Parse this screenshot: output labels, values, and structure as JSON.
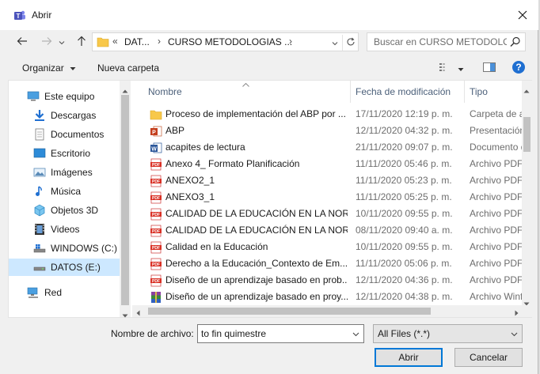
{
  "window": {
    "title": "Abrir"
  },
  "address": {
    "overflow": "«",
    "crumbs": [
      "DAT...",
      "CURSO METODOLOGIAS ..."
    ],
    "separator": "›"
  },
  "search": {
    "placeholder": "Buscar en CURSO METODOLO..."
  },
  "toolbar": {
    "organize": "Organizar",
    "new_folder": "Nueva carpeta"
  },
  "sidebar": {
    "items": [
      {
        "label": "Este equipo",
        "icon": "computer-icon"
      },
      {
        "label": "Descargas",
        "icon": "download-icon"
      },
      {
        "label": "Documentos",
        "icon": "documents-icon"
      },
      {
        "label": "Escritorio",
        "icon": "desktop-icon"
      },
      {
        "label": "Imágenes",
        "icon": "pictures-icon"
      },
      {
        "label": "Música",
        "icon": "music-icon"
      },
      {
        "label": "Objetos 3D",
        "icon": "3d-objects-icon"
      },
      {
        "label": "Videos",
        "icon": "videos-icon"
      },
      {
        "label": "WINDOWS (C:)",
        "icon": "windows-drive-icon"
      },
      {
        "label": "DATOS (E:)",
        "icon": "drive-icon"
      },
      {
        "label": "Red",
        "icon": "network-icon"
      }
    ]
  },
  "columns": {
    "name": "Nombre",
    "date": "Fecha de modificación",
    "type": "Tipo"
  },
  "files": [
    {
      "name": "Proceso de implementación del ABP por ...",
      "date": "17/11/2020 12:19 p. m.",
      "type": "Carpeta de ar",
      "icon": "folder-icon"
    },
    {
      "name": "ABP",
      "date": "12/11/2020 04:32 p. m.",
      "type": "Presentación",
      "icon": "powerpoint-icon"
    },
    {
      "name": "acapites de lectura",
      "date": "21/11/2020 09:07 p. m.",
      "type": "Documento d",
      "icon": "word-icon"
    },
    {
      "name": "Anexo 4_ Formato Planificación",
      "date": "11/11/2020 05:46 p. m.",
      "type": "Archivo PDF",
      "icon": "pdf-icon"
    },
    {
      "name": "ANEXO2_1",
      "date": "11/11/2020 05:23 p. m.",
      "type": "Archivo PDF",
      "icon": "pdf-icon"
    },
    {
      "name": "ANEXO3_1",
      "date": "11/11/2020 05:25 p. m.",
      "type": "Archivo PDF",
      "icon": "pdf-icon"
    },
    {
      "name": "CALIDAD DE LA EDUCACIÓN EN LA NOR...",
      "date": "10/11/2020 09:55 p. m.",
      "type": "Archivo PDF",
      "icon": "pdf-icon"
    },
    {
      "name": "CALIDAD DE LA EDUCACIÓN EN LA NOR...",
      "date": "08/11/2020 09:40 a. m.",
      "type": "Archivo PDF",
      "icon": "pdf-icon"
    },
    {
      "name": "Calidad en la Educación",
      "date": "10/11/2020 09:55 p. m.",
      "type": "Archivo PDF",
      "icon": "pdf-icon"
    },
    {
      "name": "Derecho a la Educación_Contexto de Em...",
      "date": "11/11/2020 05:06 p. m.",
      "type": "Archivo PDF",
      "icon": "pdf-icon"
    },
    {
      "name": "Diseño de un aprendizaje basado en prob...",
      "date": "12/11/2020 04:36 p. m.",
      "type": "Archivo PDF",
      "icon": "pdf-icon"
    },
    {
      "name": "Diseño de un aprendizaje basado en proy...",
      "date": "12/11/2020 04:38 p. m.",
      "type": "Archivo Winf",
      "icon": "winrar-icon"
    }
  ],
  "bottom": {
    "filename_label": "Nombre de archivo:",
    "filename_value": "to fin quimestre",
    "filter_value": "All Files (*.*)",
    "open_label": "Abrir",
    "cancel_label": "Cancelar"
  },
  "colors": {
    "accent": "#0078d7",
    "selected_bg": "#cde8ff",
    "pdf_red": "#d93025",
    "folder": "#f8c84a"
  }
}
